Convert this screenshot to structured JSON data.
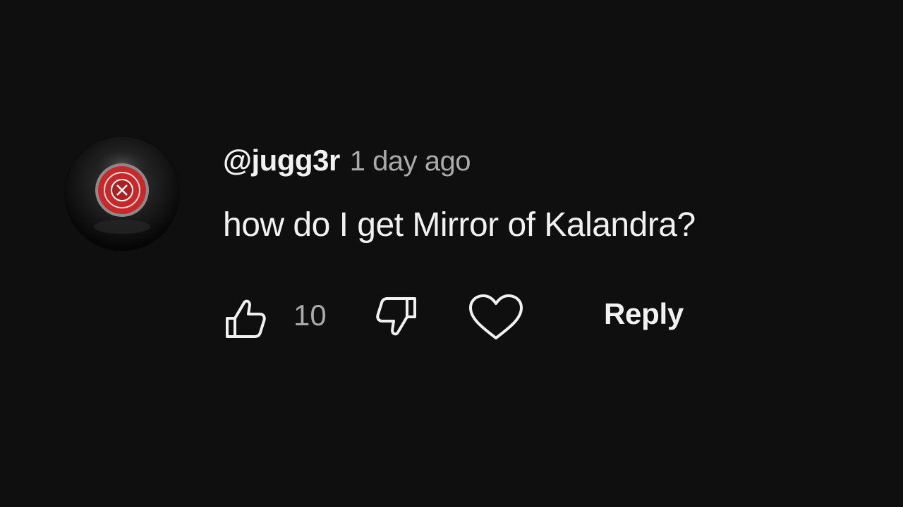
{
  "comment": {
    "author": "@jugg3r",
    "timestamp": "1 day ago",
    "text": "how do I get Mirror of Kalandra?",
    "like_count": "10",
    "reply_label": "Reply",
    "avatar_icon": "dark-orb-with-red-badge",
    "like_icon": "thumbs-up-icon",
    "dislike_icon": "thumbs-down-icon",
    "heart_icon": "heart-icon"
  },
  "colors": {
    "background": "#0f0f0f",
    "primary_text": "#f1f1f1",
    "secondary_text": "#aaaaaa",
    "badge_red": "#c8282a"
  }
}
